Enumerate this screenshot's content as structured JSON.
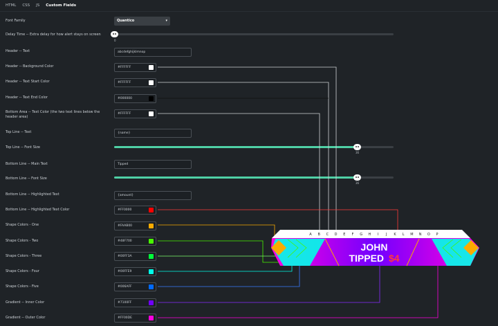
{
  "tabs": [
    {
      "label": "HTML",
      "active": false
    },
    {
      "label": "CSS",
      "active": false
    },
    {
      "label": "JS",
      "active": false
    },
    {
      "label": "Custom Fields",
      "active": true
    }
  ],
  "fields": {
    "font_family": {
      "label": "Font Family",
      "value": "Quantico"
    },
    "delay_time": {
      "label": "Delay Time -- Extra delay for how alert stays on screen",
      "value": "0",
      "fraction": 0.0
    },
    "header_text": {
      "label": "Header -- Text",
      "value": "abcdefghijklmnop"
    },
    "header_bg": {
      "label": "Header -- Background Color",
      "value": "#FFFFFF",
      "color": "#ffffff"
    },
    "header_text_start": {
      "label": "Header -- Text Start Color",
      "value": "#FFFFFF",
      "color": "#ffffff"
    },
    "header_text_end": {
      "label": "Header -- Text End Color",
      "value": "#000000",
      "color": "#000000"
    },
    "bottom_area_color": {
      "label": "Bottom Area -- Text Color (the two text lines below the header area)",
      "value": "#FFFFFF",
      "color": "#ffffff"
    },
    "top_line_text": {
      "label": "Top Line -- Text",
      "value": "{name}"
    },
    "top_line_size": {
      "label": "Top Line -- Font Size",
      "value": "36",
      "fraction": 0.87
    },
    "bottom_main_text": {
      "label": "Bottom Line -- Main Text",
      "value": "Tipped"
    },
    "bottom_line_size": {
      "label": "Bottom Line -- Font Size",
      "value": "36",
      "fraction": 0.87
    },
    "bottom_highlight_text": {
      "label": "Bottom Line -- Highlighted Text",
      "value": "{amount}"
    },
    "bottom_highlight_color": {
      "label": "Bottom Line -- Highlighted Text Color",
      "value": "#FF0000",
      "color": "#ff0000"
    },
    "shape_one": {
      "label": "Shape Colors - One",
      "value": "#FAAB00",
      "color": "#faab00"
    },
    "shape_two": {
      "label": "Shape Colors - Two",
      "value": "#48F700",
      "color": "#48f700"
    },
    "shape_three": {
      "label": "Shape Colors - Three",
      "value": "#00FF3A",
      "color": "#00ff3a"
    },
    "shape_four": {
      "label": "Shape Colors - Four",
      "value": "#00FFE9",
      "color": "#00ffe9"
    },
    "shape_five": {
      "label": "Shape Colors - Five",
      "value": "#006AFF",
      "color": "#006aff"
    },
    "gradient_inner": {
      "label": "Gradient -- Inner Color",
      "value": "#7100FF",
      "color": "#7100ff"
    },
    "gradient_outer": {
      "label": "Gradient -- Outer Color",
      "value": "#FF00DE",
      "color": "#ff00de"
    }
  },
  "banner": {
    "letters": [
      "A",
      "B",
      "C",
      "D",
      "E",
      "F",
      "G",
      "H",
      "I",
      "J",
      "K",
      "L",
      "M",
      "N",
      "O",
      "P"
    ],
    "line1": "JOHN",
    "line2_main": "TIPPED",
    "line2_highlight": "$4"
  },
  "connector_colors": {
    "white": "#cfd3d6",
    "black": "#222222",
    "red": "#ff3b3b",
    "orange": "#faab00",
    "green": "#48f700",
    "lime": "#7dff6a",
    "cyan": "#00ffe9",
    "blue": "#3a7bff",
    "purple": "#8a2bff",
    "pink": "#ff00de"
  }
}
